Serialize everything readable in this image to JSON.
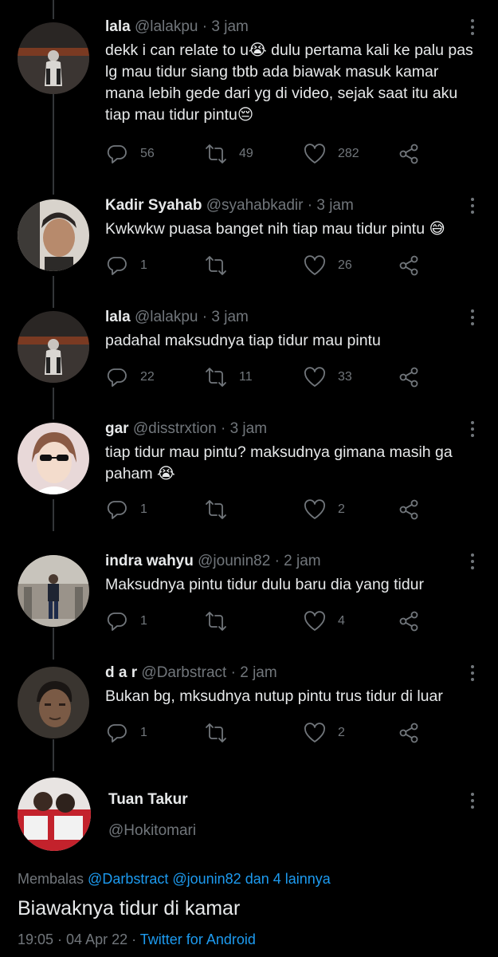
{
  "replies": [
    {
      "name": "lala",
      "handle": "@lalakpu",
      "time": "3 jam",
      "text": "dekk i can relate to u😭 dulu pertama kali ke palu pas lg mau tidur siang tbtb ada biawak masuk kamar mana lebih gede dari yg di video, sejak saat itu aku tiap mau tidur pintu😔",
      "replies_count": "56",
      "retweets_count": "49",
      "likes_count": "282"
    },
    {
      "name": "Kadir Syahab",
      "handle": "@syahabkadir",
      "time": "3 jam",
      "text": "Kwkwkw puasa banget nih tiap mau tidur pintu 😅",
      "replies_count": "1",
      "retweets_count": "",
      "likes_count": "26"
    },
    {
      "name": "lala",
      "handle": "@lalakpu",
      "time": "3 jam",
      "text": "padahal maksudnya tiap tidur mau pintu",
      "replies_count": "22",
      "retweets_count": "11",
      "likes_count": "33"
    },
    {
      "name": "gar",
      "handle": "@disstrxtion",
      "time": "3 jam",
      "text": "tiap tidur mau pintu? maksudnya gimana masih ga paham 😭",
      "replies_count": "1",
      "retweets_count": "",
      "likes_count": "2"
    },
    {
      "name": "indra wahyu",
      "handle": "@jounin82",
      "time": "2 jam",
      "text": "Maksudnya pintu tidur dulu baru dia yang tidur",
      "replies_count": "1",
      "retweets_count": "",
      "likes_count": "4"
    },
    {
      "name": "d a r",
      "handle": "@Darbstract",
      "time": "2 jam",
      "text": "Bukan bg, mksudnya nutup pintu trus tidur di luar",
      "replies_count": "1",
      "retweets_count": "",
      "likes_count": "2"
    }
  ],
  "main": {
    "name": "Tuan Takur",
    "handle": "@Hokitomari",
    "replying_prefix": "Membalas",
    "replying_to": "@Darbstract @jounin82",
    "replying_and": "dan",
    "replying_others": "4 lainnya",
    "text": "Biawaknya tidur di kamar",
    "timestamp": "19:05 · 04 Apr 22 ·",
    "source": "Twitter for Android"
  },
  "separator": "·",
  "icons": [
    "reply-icon",
    "retweet-icon",
    "like-icon",
    "share-icon",
    "more-icon"
  ],
  "colors": {
    "background": "#000000",
    "text": "#e7e9ea",
    "muted": "#71767b",
    "link": "#1d9bf0"
  }
}
